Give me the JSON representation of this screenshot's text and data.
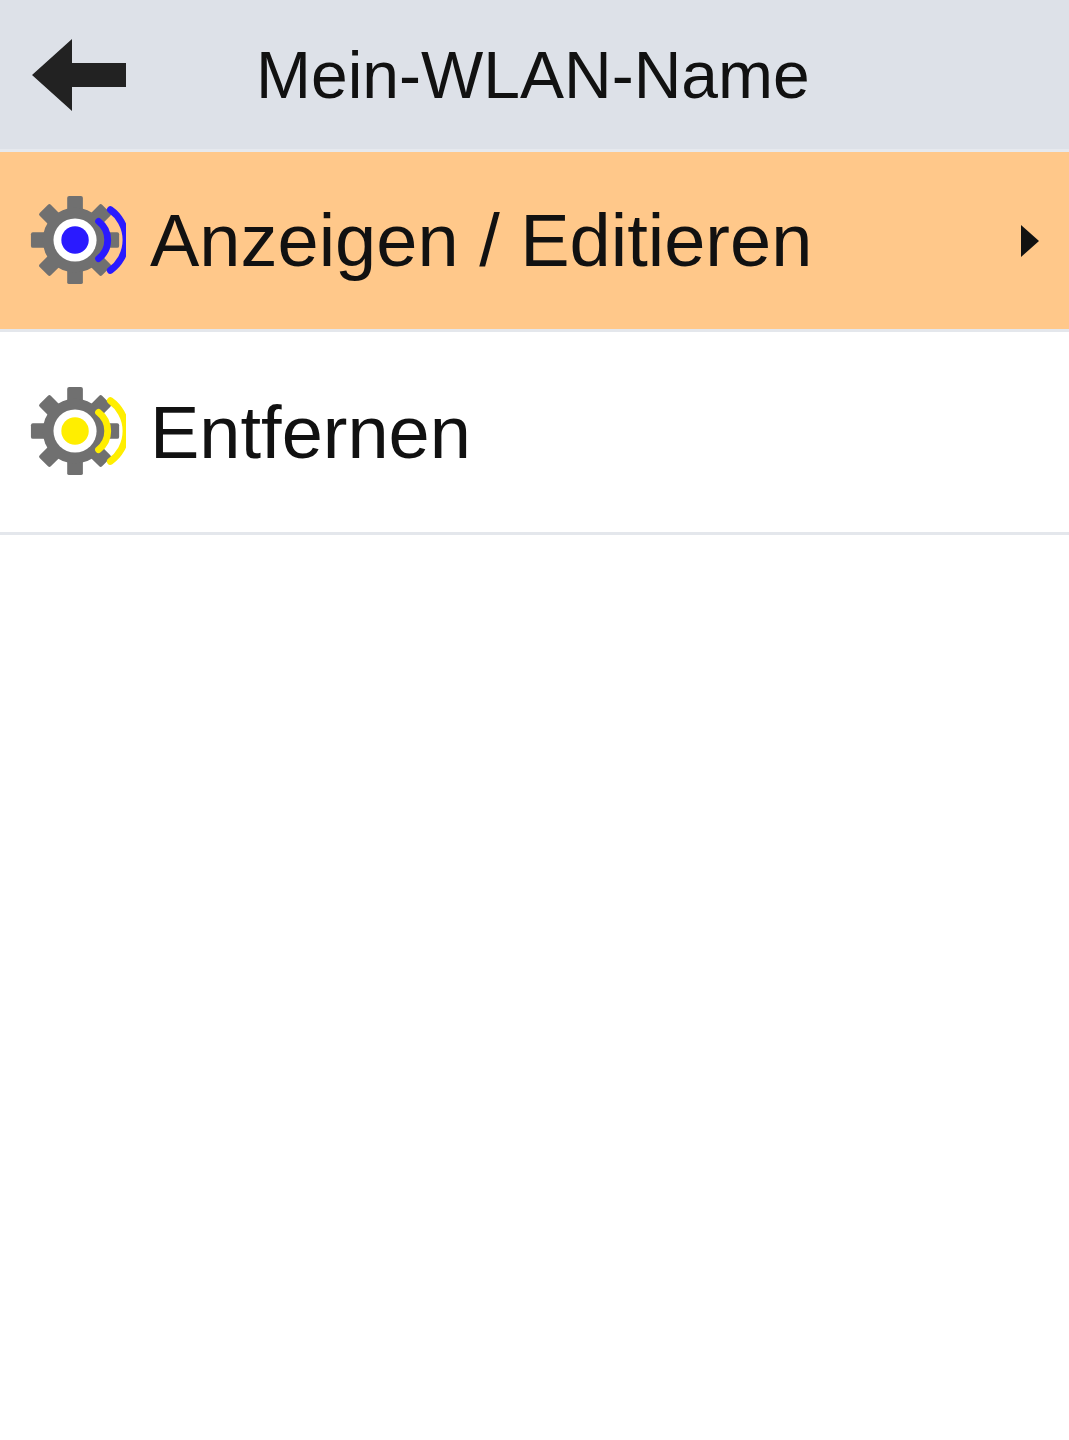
{
  "header": {
    "title": "Mein-WLAN-Name"
  },
  "menu": [
    {
      "label": "Anzeigen / Editieren",
      "selected": true,
      "color": "#2a1aff",
      "submenu": true
    },
    {
      "label": "Entfernen",
      "selected": false,
      "color": "#ffee00",
      "submenu": false
    }
  ]
}
